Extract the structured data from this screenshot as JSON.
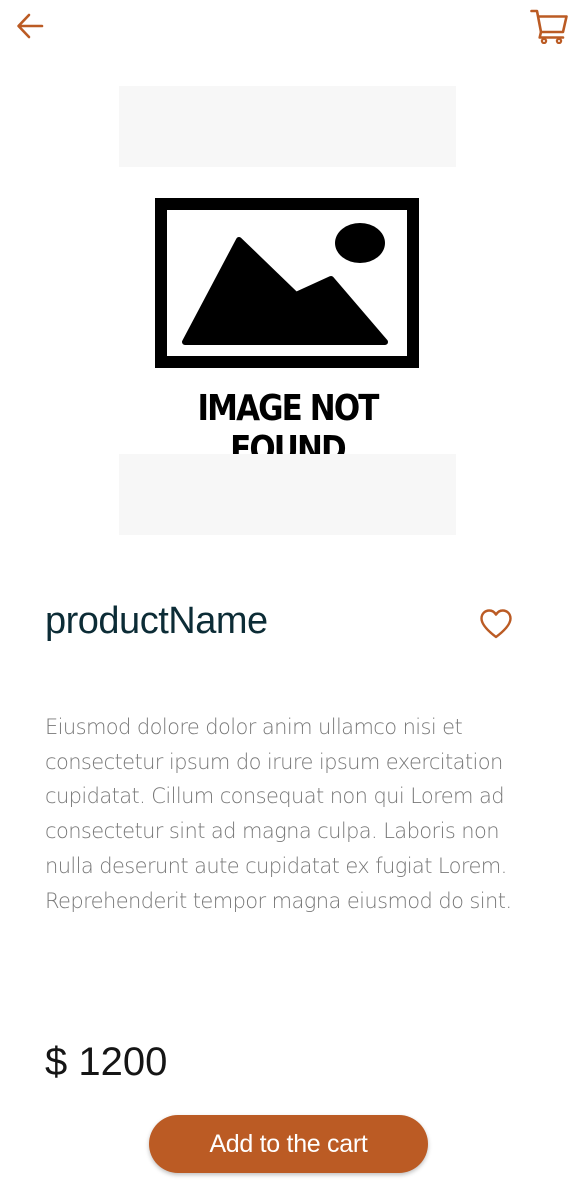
{
  "header": {
    "back_icon": "arrow-left-icon",
    "cart_icon": "shopping-cart-icon"
  },
  "product_image": {
    "caption": "IMAGE NOT FOUND",
    "icon": "image-placeholder-icon"
  },
  "product": {
    "name": "productName",
    "favorite_icon": "heart-outline-icon",
    "description": "Eiusmod dolore dolor anim ullamco nisi et consectetur ipsum do irure ipsum exercitation cupidatat. Cillum consequat non qui Lorem ad consectetur sint ad magna culpa. Laboris non nulla deserunt aute cupidatat ex fugiat Lorem. Reprehenderit tempor magna eiusmod do sint.",
    "price": "$ 1200"
  },
  "actions": {
    "add_to_cart_label": "Add to the cart"
  },
  "colors": {
    "accent": "#bb5b24",
    "title": "#0c2c36",
    "body_text": "#787878",
    "price_text": "#151515",
    "image_band": "#f7f7f7"
  }
}
